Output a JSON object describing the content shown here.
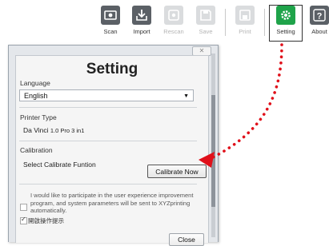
{
  "toolbar": {
    "items": [
      {
        "label": "Scan",
        "icon": "scan-icon",
        "state": "normal"
      },
      {
        "label": "Import",
        "icon": "import-icon",
        "state": "normal"
      },
      {
        "label": "Rescan",
        "icon": "rescan-icon",
        "state": "disabled"
      },
      {
        "label": "Save",
        "icon": "save-icon",
        "state": "disabled"
      },
      {
        "label": "Print",
        "icon": "print-icon",
        "state": "disabled"
      },
      {
        "label": "Setting",
        "icon": "gear-icon",
        "state": "active"
      },
      {
        "label": "About",
        "icon": "help-icon",
        "state": "normal"
      }
    ]
  },
  "dialog": {
    "title": "Setting",
    "close_glyph": "✕",
    "language": {
      "label": "Language",
      "value": "English"
    },
    "printer_type": {
      "label": "Printer Type",
      "value": "Da Vinci",
      "model": "1.0 Pro 3 in1"
    },
    "calibration": {
      "label": "Calibration",
      "text": "Select Calibrate Funtion",
      "button": "Calibrate Now"
    },
    "experience": {
      "text": "I would like to participate in the user experience improvement program, and system parameters will be sent to XYZprinting automatically.",
      "checked": false
    },
    "hint": {
      "label": "開啟操作提示",
      "checked": true
    },
    "close_button": "Close"
  },
  "annotation": {
    "color": "#e0101a"
  },
  "colors": {
    "accent": "#1fa34a",
    "annotation": "#e0101a"
  }
}
